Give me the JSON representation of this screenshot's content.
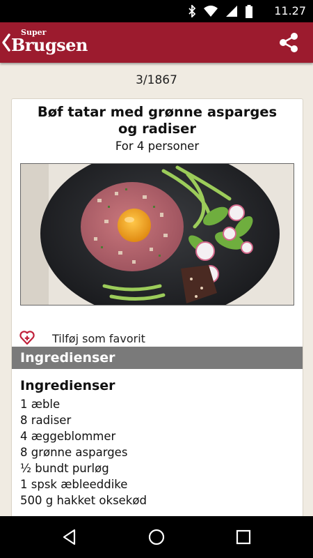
{
  "status_bar": {
    "time": "11.27",
    "icons": [
      "bluetooth-icon",
      "wifi-icon",
      "signal-icon",
      "battery-icon"
    ]
  },
  "app_bar": {
    "logo_top": "Super",
    "logo_main": "Brugsen",
    "background": "#9c1b2e",
    "actions": [
      "share-icon"
    ]
  },
  "pager": {
    "counter": "3/1867"
  },
  "recipe": {
    "title_line1": "Bøf tatar med grønne asparges",
    "title_line2": "og radiser",
    "servings": "For 4 personer",
    "favorite_label": "Tilføj som favorit",
    "section_header": "Ingredienser",
    "ingredients_heading": "Ingredienser",
    "ingredients": [
      "1 æble",
      "8 radiser",
      "4 æggeblommer",
      "8 grønne asparges",
      "½ bundt purløg",
      "1 spsk æbleeddike",
      "500 g hakket oksekød"
    ]
  },
  "nav_bar": {
    "buttons": [
      "back-icon",
      "home-icon",
      "recents-icon"
    ]
  }
}
